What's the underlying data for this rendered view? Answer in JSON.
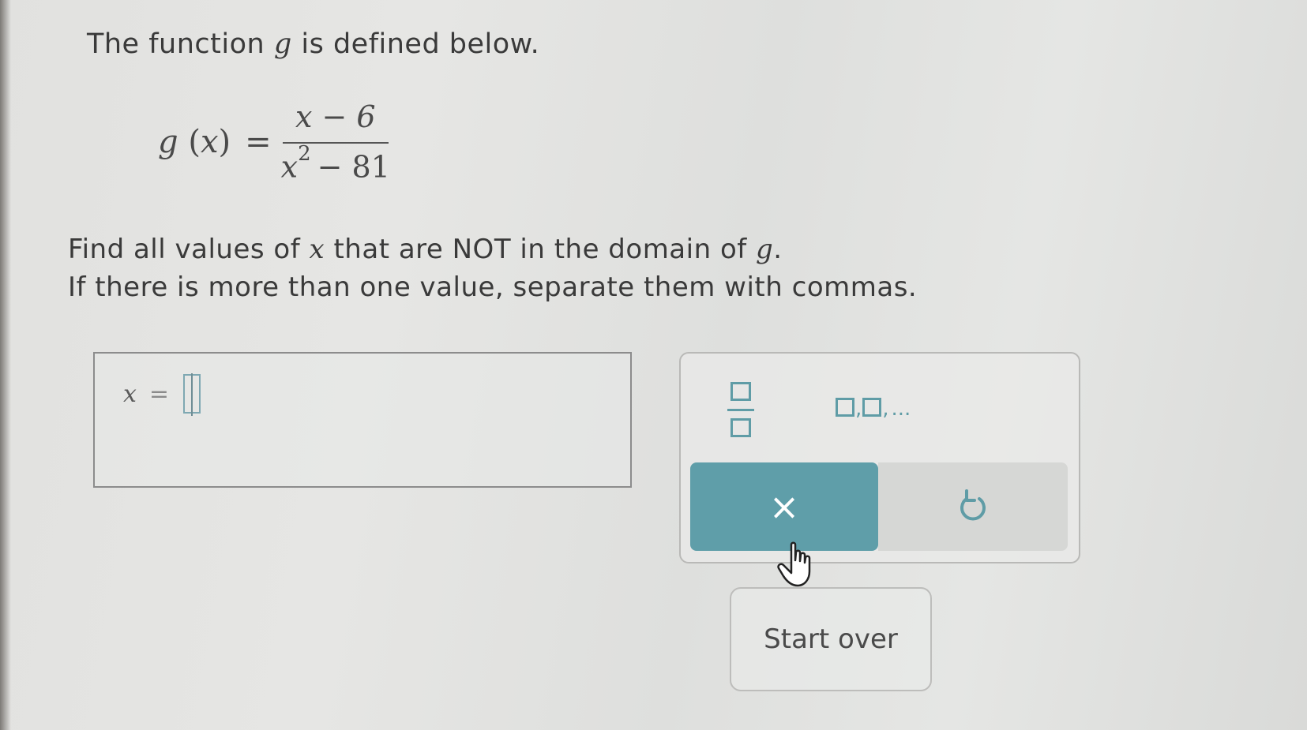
{
  "question": {
    "intro_prefix": "The function ",
    "intro_var": "g",
    "intro_suffix": " is defined below.",
    "formula": {
      "fn_name": "g",
      "fn_open": "(",
      "fn_arg": "x",
      "fn_close": ")",
      "equals": "=",
      "numerator": "x − 6",
      "denominator_base": "x",
      "denominator_exp": "2",
      "denominator_rest": "− 81"
    },
    "instruction_1_prefix": "Find all values of ",
    "instruction_1_var": "x",
    "instruction_1_mid": " that are NOT in the domain of ",
    "instruction_1_var2": "g",
    "instruction_1_suffix": ".",
    "instruction_2": "If there is more than one value, separate them with commas."
  },
  "answer": {
    "variable": "x",
    "equals": "=",
    "value": ""
  },
  "keypad": {
    "list_comma": ",",
    "list_dots": "...",
    "clear_label": "×",
    "icons": {
      "fraction": "fraction-icon",
      "list": "list-icon",
      "clear": "close-icon",
      "undo": "undo-icon"
    },
    "accent_color": "#5f9ea9"
  },
  "start_over_label": "Start over"
}
